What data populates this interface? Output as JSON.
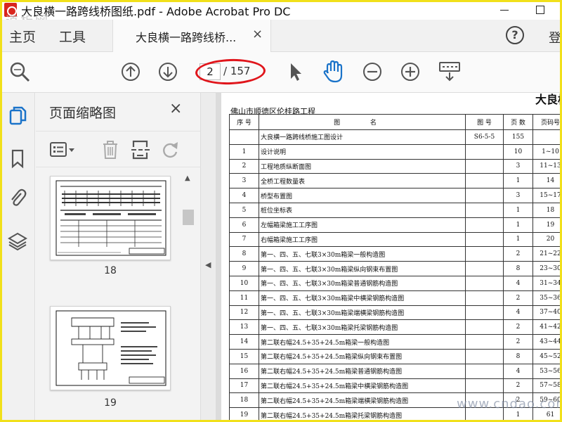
{
  "window": {
    "title": "大良横一路跨线桥图纸.pdf - Adobe Acrobat Pro DC",
    "watermark_top": "道析网",
    "watermark_bottom": "www.cndao.com"
  },
  "menu": {
    "home": "主页",
    "tools": "工具",
    "tab_label": "大良横一路跨线桥...",
    "tab_close": "×",
    "help": "?",
    "signin": "登"
  },
  "toolbar": {
    "current_page": "2",
    "total_pages": "/ 157",
    "highlight_color": "#e0151b"
  },
  "thumbnails": {
    "title": "页面缩略图",
    "close": "×",
    "pages": [
      {
        "num": "18"
      },
      {
        "num": "19"
      }
    ]
  },
  "document": {
    "heading": "大良横",
    "project": "佛山市顺德区伦桂路工程",
    "headers": {
      "idx": "序 号",
      "title": "图 名",
      "code": "图 号",
      "pages": "页 数",
      "range": "页码号"
    },
    "rows": [
      {
        "idx": "",
        "title": "大良横一路跨线桥施工图设计",
        "code": "S6-5-5",
        "pages": "155",
        "range": ""
      },
      {
        "idx": "1",
        "title": "设计说明",
        "code": "",
        "pages": "10",
        "range": "1~10"
      },
      {
        "idx": "2",
        "title": "工程地质纵断面图",
        "code": "",
        "pages": "3",
        "range": "11~13"
      },
      {
        "idx": "3",
        "title": "全桥工程数量表",
        "code": "",
        "pages": "1",
        "range": "14"
      },
      {
        "idx": "4",
        "title": "桥型布置图",
        "code": "",
        "pages": "3",
        "range": "15~17"
      },
      {
        "idx": "5",
        "title": "桩位坐标表",
        "code": "",
        "pages": "1",
        "range": "18"
      },
      {
        "idx": "6",
        "title": "左幅箱梁施工工序图",
        "code": "",
        "pages": "1",
        "range": "19"
      },
      {
        "idx": "7",
        "title": "右幅箱梁施工工序图",
        "code": "",
        "pages": "1",
        "range": "20"
      },
      {
        "idx": "8",
        "title": "第一、四、五、七联3×30m箱梁一般构造图",
        "code": "",
        "pages": "2",
        "range": "21~22"
      },
      {
        "idx": "9",
        "title": "第一、四、五、七联3×30m箱梁纵向钢束布置图",
        "code": "",
        "pages": "8",
        "range": "23~30"
      },
      {
        "idx": "10",
        "title": "第一、四、五、七联3×30m箱梁普通钢筋构造图",
        "code": "",
        "pages": "4",
        "range": "31~34"
      },
      {
        "idx": "11",
        "title": "第一、四、五、七联3×30m箱梁中横梁钢筋构造图",
        "code": "",
        "pages": "2",
        "range": "35~36"
      },
      {
        "idx": "12",
        "title": "第一、四、五、七联3×30m箱梁端横梁钢筋构造图",
        "code": "",
        "pages": "4",
        "range": "37~40"
      },
      {
        "idx": "13",
        "title": "第一、四、五、七联3×30m箱梁托梁钢筋构造图",
        "code": "",
        "pages": "2",
        "range": "41~42"
      },
      {
        "idx": "14",
        "title": "第二联右幅24.5+35+24.5m箱梁一般构造图",
        "code": "",
        "pages": "2",
        "range": "43~44"
      },
      {
        "idx": "15",
        "title": "第二联右幅24.5+35+24.5m箱梁纵向钢束布置图",
        "code": "",
        "pages": "8",
        "range": "45~52"
      },
      {
        "idx": "16",
        "title": "第二联右幅24.5+35+24.5m箱梁普通钢筋构造图",
        "code": "",
        "pages": "4",
        "range": "53~56"
      },
      {
        "idx": "17",
        "title": "第二联右幅24.5+35+24.5m箱梁中横梁钢筋构造图",
        "code": "",
        "pages": "2",
        "range": "57~58"
      },
      {
        "idx": "18",
        "title": "第二联右幅24.5+35+24.5m箱梁端横梁钢筋构造图",
        "code": "",
        "pages": "2",
        "range": "59~60"
      },
      {
        "idx": "19",
        "title": "第二联右幅24.5+35+24.5m箱梁托梁钢筋构造图",
        "code": "",
        "pages": "1",
        "range": "61"
      }
    ]
  },
  "icons": {
    "accent": "#1a73c9"
  }
}
